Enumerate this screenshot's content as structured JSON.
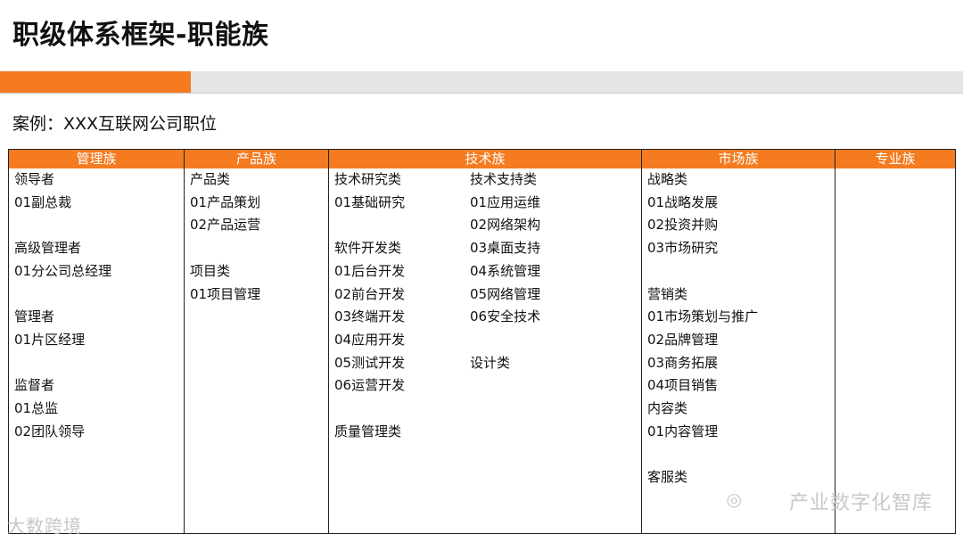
{
  "title": "职级体系框架-职能族",
  "subtitle": "案例：XXX互联网公司职位",
  "headers": [
    "管理族",
    "产品族",
    "技术族",
    "市场族",
    "专业族"
  ],
  "col_mgmt": [
    "领导者",
    "01副总裁",
    "",
    "高级管理者",
    "01分公司总经理",
    "",
    "管理者",
    "01片区经理",
    "",
    "监督者",
    "01总监",
    "02团队领导"
  ],
  "col_product": [
    "产品类",
    "01产品策划",
    "02产品运营",
    "",
    "项目类",
    "01项目管理"
  ],
  "col_tech1": [
    "技术研究类",
    "01基础研究",
    "",
    "软件开发类",
    "01后台开发",
    "02前台开发",
    "03终端开发",
    "04应用开发",
    "05测试开发",
    "06运营开发",
    "",
    "质量管理类"
  ],
  "col_tech2": [
    "技术支持类",
    "01应用运维",
    "02网络架构",
    "03桌面支持",
    "04系统管理",
    "05网络管理",
    "06安全技术",
    "",
    "设计类"
  ],
  "col_market": [
    "战略类",
    "01战略发展",
    "02投资并购",
    "03市场研究",
    "",
    "营销类",
    "01市场策划与推广",
    "02品牌管理",
    "03商务拓展",
    "04项目销售",
    "内容类",
    "01内容管理",
    "",
    "客服类"
  ],
  "watermark_right": "产业数字化智库",
  "watermark_left": "大数跨境"
}
